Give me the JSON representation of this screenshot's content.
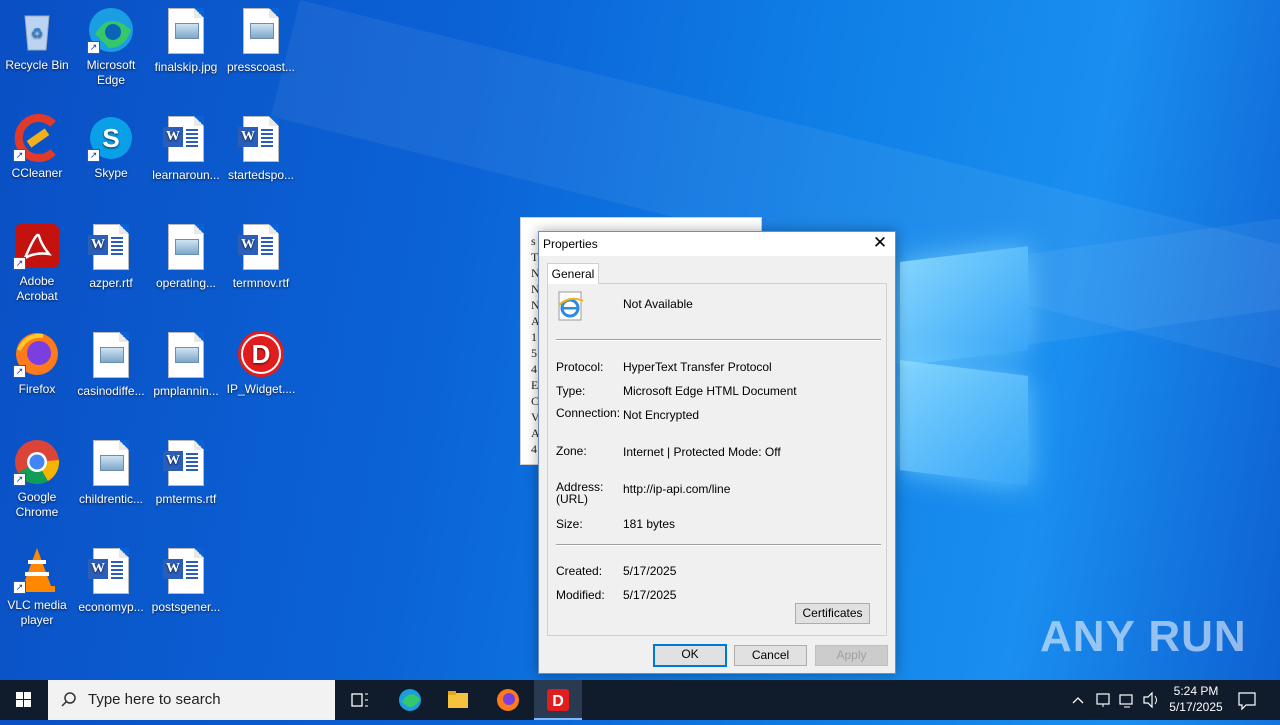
{
  "desktop": {
    "icons": [
      {
        "label": "Recycle Bin",
        "icon": "recycle-bin-icon"
      },
      {
        "label": "Microsoft Edge",
        "icon": "edge-icon"
      },
      {
        "label": "finalskip.jpg",
        "icon": "image-file-icon"
      },
      {
        "label": "presscoast...",
        "icon": "image-file-icon"
      },
      {
        "label": "CCleaner",
        "icon": "ccleaner-icon"
      },
      {
        "label": "Skype",
        "icon": "skype-icon"
      },
      {
        "label": "learnaroun...",
        "icon": "word-doc-icon"
      },
      {
        "label": "startedspo...",
        "icon": "word-doc-icon"
      },
      {
        "label": "Adobe Acrobat",
        "icon": "acrobat-icon"
      },
      {
        "label": "azper.rtf",
        "icon": "word-doc-icon"
      },
      {
        "label": "operating...",
        "icon": "image-file-icon"
      },
      {
        "label": "termnov.rtf",
        "icon": "word-doc-icon"
      },
      {
        "label": "Firefox",
        "icon": "firefox-icon"
      },
      {
        "label": "casinodiffe...",
        "icon": "image-file-icon"
      },
      {
        "label": "pmplannin...",
        "icon": "image-file-icon"
      },
      {
        "label": "IP_Widget....",
        "icon": "ip-widget-icon"
      },
      {
        "label": "Google Chrome",
        "icon": "chrome-icon"
      },
      {
        "label": "childrentic...",
        "icon": "image-file-icon"
      },
      {
        "label": "pmterms.rtf",
        "icon": "word-doc-icon"
      },
      {
        "label": "VLC media player",
        "icon": "vlc-icon"
      },
      {
        "label": "economyp...",
        "icon": "word-doc-icon"
      },
      {
        "label": "postsgener...",
        "icon": "word-doc-icon"
      }
    ]
  },
  "background_window": {
    "lines": [
      "s",
      "T",
      "N",
      "N",
      "N",
      "A",
      "1",
      "5",
      "4",
      "E",
      "C",
      "V",
      "A",
      "4"
    ]
  },
  "dialog": {
    "title": "Properties",
    "tab": "General",
    "name": "Not Available",
    "rows": {
      "protocol_label": "Protocol:",
      "protocol": "HyperText Transfer Protocol",
      "type_label": "Type:",
      "type": "Microsoft Edge HTML Document",
      "connection_label": "Connection:",
      "connection": "Not Encrypted",
      "zone_label": "Zone:",
      "zone": "Internet | Protected Mode: Off",
      "address_label": "Address:",
      "address_label2": "(URL)",
      "address": "http://ip-api.com/line",
      "size_label": "Size:",
      "size": "181 bytes",
      "created_label": "Created:",
      "created": "5/17/2025",
      "modified_label": "Modified:",
      "modified": "5/17/2025"
    },
    "certificates_button": "Certificates",
    "ok_button": "OK",
    "cancel_button": "Cancel",
    "apply_button": "Apply"
  },
  "watermark": "ANY RUN",
  "taskbar": {
    "search_placeholder": "Type here to search",
    "time": "5:24 PM",
    "date": "5/17/2025"
  }
}
